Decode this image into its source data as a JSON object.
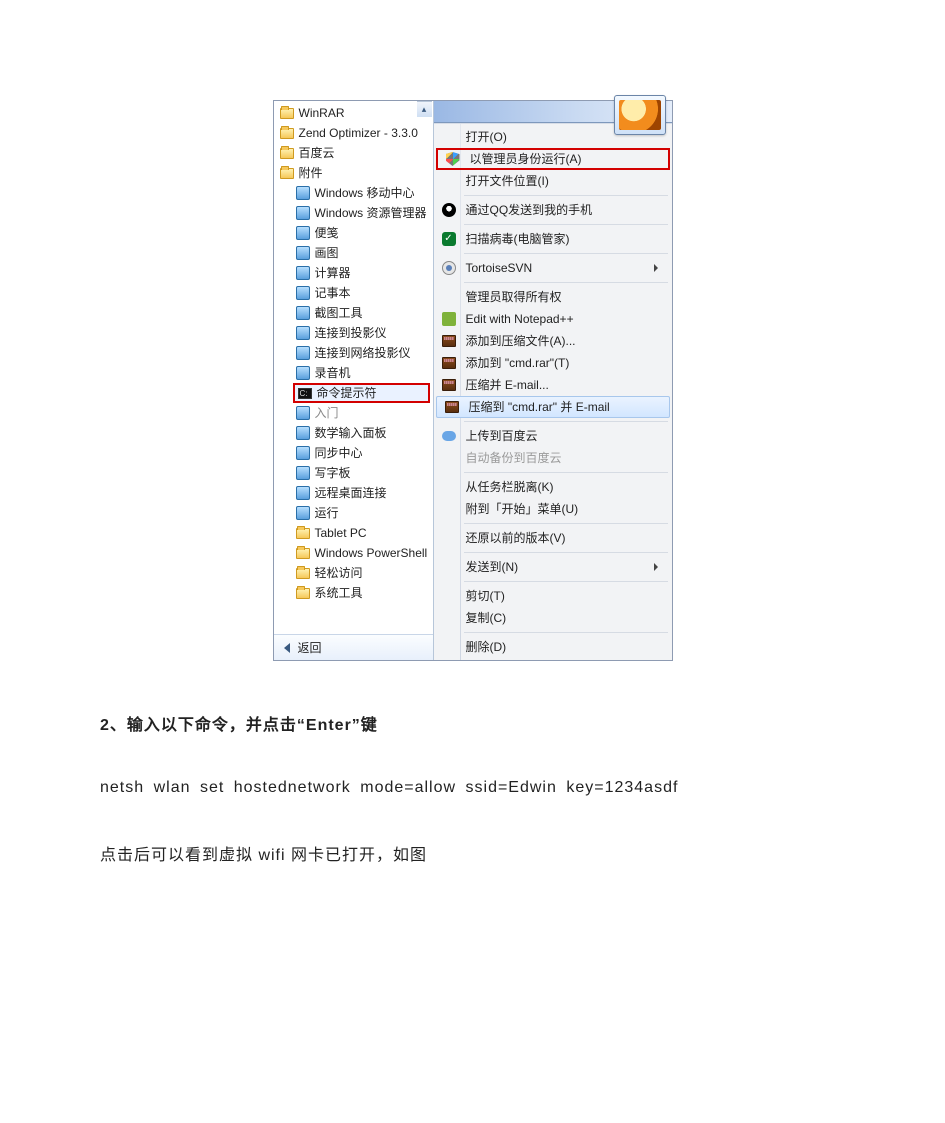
{
  "screenshot": {
    "left_panel": {
      "top_items": [
        {
          "label": "WinRAR",
          "icon": "folder",
          "indent": 0
        },
        {
          "label": "Zend Optimizer - 3.3.0",
          "icon": "folder",
          "indent": 0
        },
        {
          "label": "百度云",
          "icon": "folder",
          "indent": 0
        },
        {
          "label": "附件",
          "icon": "folder",
          "indent": 0
        },
        {
          "label": "Windows 移动中心",
          "icon": "app",
          "indent": 1
        },
        {
          "label": "Windows 资源管理器",
          "icon": "app",
          "indent": 1
        },
        {
          "label": "便笺",
          "icon": "app",
          "indent": 1
        },
        {
          "label": "画图",
          "icon": "app",
          "indent": 1
        },
        {
          "label": "计算器",
          "icon": "app",
          "indent": 1
        },
        {
          "label": "记事本",
          "icon": "app",
          "indent": 1
        },
        {
          "label": "截图工具",
          "icon": "app",
          "indent": 1
        },
        {
          "label": "连接到投影仪",
          "icon": "app",
          "indent": 1
        },
        {
          "label": "连接到网络投影仪",
          "icon": "app",
          "indent": 1
        },
        {
          "label": "录音机",
          "icon": "app",
          "indent": 1
        }
      ],
      "highlighted_item": {
        "label": "命令提示符",
        "icon": "cmd"
      },
      "bottom_items": [
        {
          "label": "入门",
          "icon": "app",
          "indent": 1,
          "dim": true
        },
        {
          "label": "数学输入面板",
          "icon": "app",
          "indent": 1
        },
        {
          "label": "同步中心",
          "icon": "app",
          "indent": 1
        },
        {
          "label": "写字板",
          "icon": "app",
          "indent": 1
        },
        {
          "label": "远程桌面连接",
          "icon": "app",
          "indent": 1
        },
        {
          "label": "运行",
          "icon": "app",
          "indent": 1
        },
        {
          "label": "Tablet PC",
          "icon": "folder",
          "indent": 1
        },
        {
          "label": "Windows PowerShell",
          "icon": "folder",
          "indent": 1
        },
        {
          "label": "轻松访问",
          "icon": "folder",
          "indent": 1
        },
        {
          "label": "系统工具",
          "icon": "folder",
          "indent": 1
        }
      ],
      "back_label": "返回"
    },
    "context_menu": {
      "groups": [
        [
          {
            "label": "打开(O)",
            "icon": ""
          },
          {
            "label": "以管理员身份运行(A)",
            "icon": "shield",
            "highlight_red": true
          },
          {
            "label": "打开文件位置(I)",
            "icon": ""
          }
        ],
        [
          {
            "label": "通过QQ发送到我的手机",
            "icon": "qq"
          }
        ],
        [
          {
            "label": "扫描病毒(电脑管家)",
            "icon": "av"
          }
        ],
        [
          {
            "label": "TortoiseSVN",
            "icon": "svn",
            "submenu": true
          }
        ],
        [
          {
            "label": "管理员取得所有权",
            "icon": ""
          },
          {
            "label": "Edit with Notepad++",
            "icon": "npp"
          },
          {
            "label": "添加到压缩文件(A)...",
            "icon": "rar"
          },
          {
            "label": "添加到 \"cmd.rar\"(T)",
            "icon": "rar"
          },
          {
            "label": "压缩并 E-mail...",
            "icon": "rar"
          },
          {
            "label": "压缩到 \"cmd.rar\" 并 E-mail",
            "icon": "rar",
            "hover": true
          }
        ],
        [
          {
            "label": "上传到百度云",
            "icon": "cloud"
          },
          {
            "label": "自动备份到百度云",
            "icon": "",
            "disabled": true
          }
        ],
        [
          {
            "label": "从任务栏脱离(K)",
            "icon": ""
          },
          {
            "label": "附到「开始」菜单(U)",
            "icon": ""
          }
        ],
        [
          {
            "label": "还原以前的版本(V)",
            "icon": ""
          }
        ],
        [
          {
            "label": "发送到(N)",
            "icon": "",
            "submenu": true
          }
        ],
        [
          {
            "label": "剪切(T)",
            "icon": ""
          },
          {
            "label": "复制(C)",
            "icon": ""
          }
        ],
        [
          {
            "label": "删除(D)",
            "icon": ""
          }
        ]
      ]
    }
  },
  "doc": {
    "step2_heading": "2、输入以下命令，并点击“Enter”键",
    "cmd_line": "netsh  wlan  set  hostednetwork  mode=allow  ssid=Edwin  key=1234asdf",
    "after_line": "点击后可以看到虚拟 wifi 网卡已打开，如图"
  }
}
